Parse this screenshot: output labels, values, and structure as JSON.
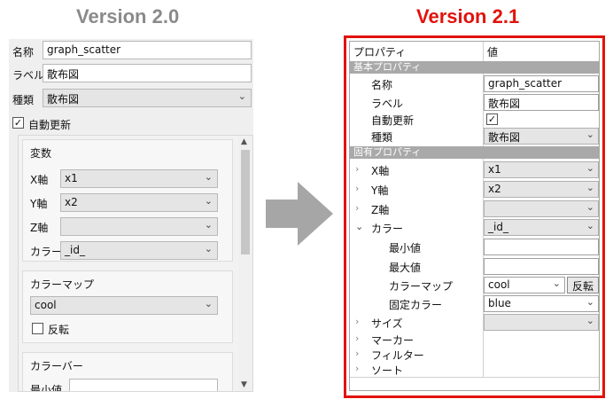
{
  "headings": {
    "left": "Version 2.0",
    "right": "Version 2.1"
  },
  "left_panel": {
    "name_label": "名称",
    "name_value": "graph_scatter",
    "label_label": "ラベル",
    "label_value": "散布図",
    "type_label": "種類",
    "type_value": "散布図",
    "auto_update_label": "自動更新",
    "auto_update_checked": true,
    "variables": {
      "title": "変数",
      "x_label": "X軸",
      "x_value": "x1",
      "y_label": "Y軸",
      "y_value": "x2",
      "z_label": "Z軸",
      "z_value": "",
      "color_label": "カラー",
      "color_value": "_id_"
    },
    "colormap": {
      "title": "カラーマップ",
      "value": "cool",
      "reverse_label": "反転",
      "reverse_checked": false
    },
    "colorbar": {
      "title": "カラーバー",
      "min_label": "最小値",
      "min_value": ""
    }
  },
  "right_panel": {
    "header": {
      "prop_col": "プロパティ",
      "value_col": "値"
    },
    "basic_section": "基本プロパティ",
    "name_label": "名称",
    "name_value": "graph_scatter",
    "label_label": "ラベル",
    "label_value": "散布図",
    "auto_update_label": "自動更新",
    "auto_update_checked": true,
    "type_label": "種類",
    "type_value": "散布図",
    "specific_section": "固有プロパティ",
    "x_label": "X軸",
    "x_value": "x1",
    "y_label": "Y軸",
    "y_value": "x2",
    "z_label": "Z軸",
    "z_value": "",
    "color_label": "カラー",
    "color_value": "_id_",
    "min_label": "最小値",
    "min_value": "",
    "max_label": "最大値",
    "max_value": "",
    "colormap_label": "カラーマップ",
    "colormap_value": "cool",
    "reverse_button": "反転",
    "fixed_color_label": "固定カラー",
    "fixed_color_value": "blue",
    "size_label": "サイズ",
    "size_value": "",
    "marker_label": "マーカー",
    "filter_label": "フィルター",
    "sort_label": "ソート"
  },
  "colors": {
    "left_heading": "#8a8a8a",
    "right_heading": "#e0130d",
    "frame": "#e2120c",
    "arrow": "#a6a6a6",
    "section_bg": "#a9a9a9"
  }
}
